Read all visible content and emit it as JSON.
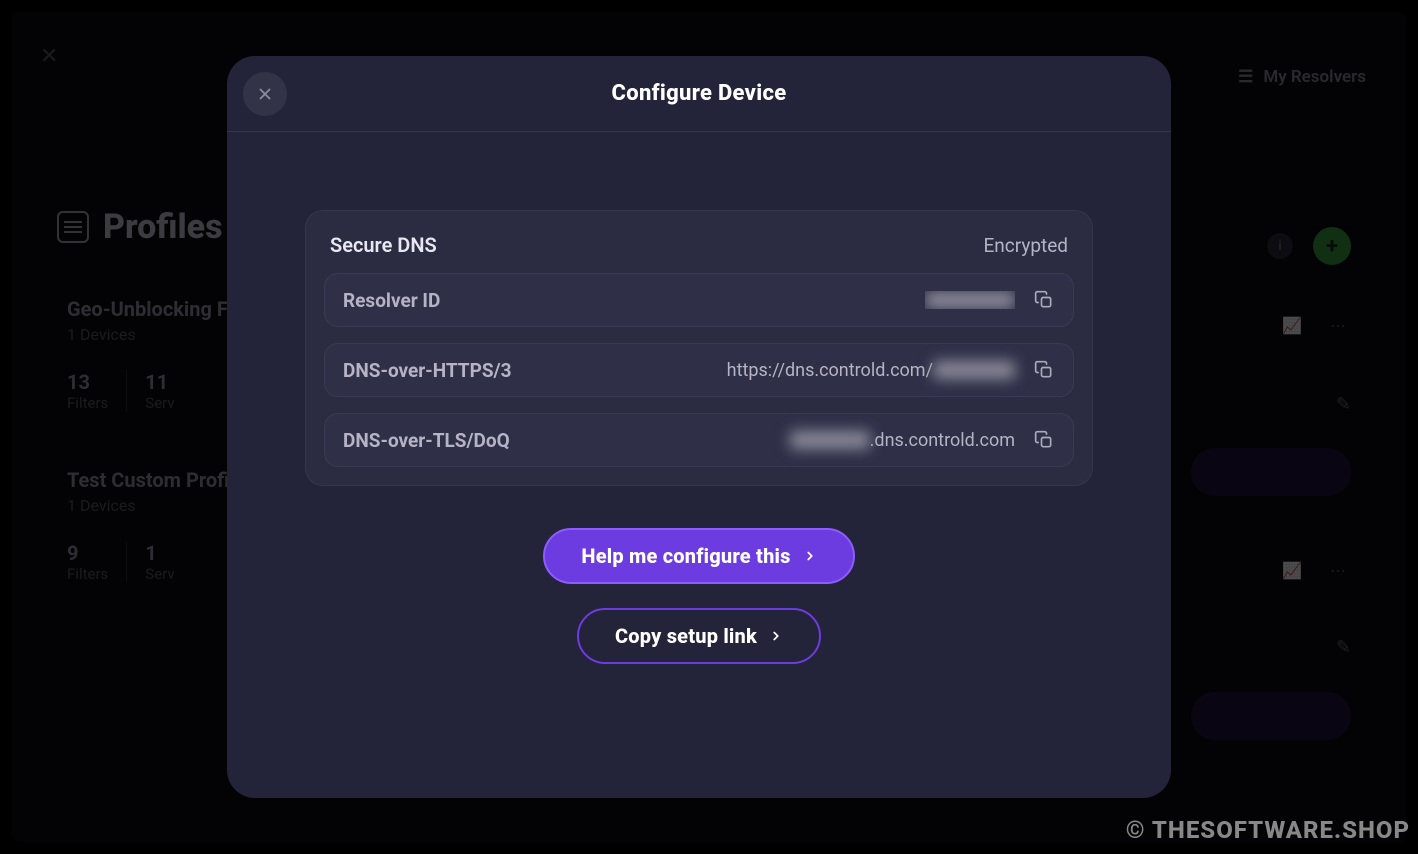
{
  "background": {
    "my_resolvers": "My Resolvers",
    "profiles_title": "Profiles",
    "profile1": {
      "name": "Geo-Unblocking F",
      "devices": "1 Devices",
      "filters_num": "13",
      "filters_label": "Filters",
      "services_num": "11",
      "services_label": "Serv"
    },
    "profile2": {
      "name": "Test Custom Profi",
      "devices": "1 Devices",
      "filters_num": "9",
      "filters_label": "Filters",
      "services_num": "1",
      "services_label": "Serv"
    }
  },
  "modal": {
    "title": "Configure Device",
    "secure": {
      "title": "Secure DNS",
      "status": "Encrypted",
      "rows": {
        "resolver": {
          "label": "Resolver ID",
          "value_redacted": true
        },
        "doh": {
          "label": "DNS-over-HTTPS/3",
          "value_prefix": "https://dns.controld.com/",
          "value_redacted": true
        },
        "dot": {
          "label": "DNS-over-TLS/DoQ",
          "value_suffix": ".dns.controld.com",
          "value_redacted": true
        }
      }
    },
    "buttons": {
      "primary": "Help me configure this",
      "secondary": "Copy setup link"
    }
  },
  "watermark": "© THESOFTWARE.SHOP"
}
